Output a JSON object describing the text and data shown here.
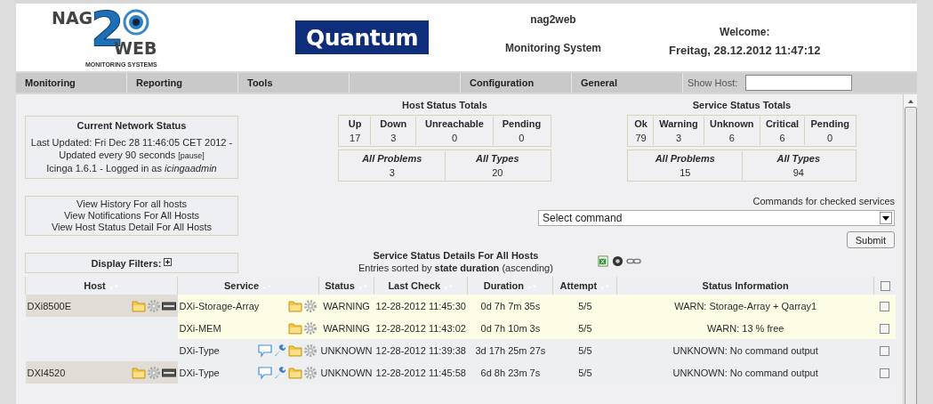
{
  "header": {
    "logo": {
      "top": "NAG",
      "digit": "2",
      "bottom": "WEB",
      "tagline": "MONITORING SYSTEMS"
    },
    "partner_logo": "Quantum",
    "site_name": "nag2web",
    "subtitle": "Monitoring System",
    "welcome": "Welcome:",
    "datetime": "Freitag, 28.12.2012 11:47:12"
  },
  "menu": {
    "left": [
      "Monitoring",
      "Reporting",
      "Tools"
    ],
    "right": [
      "Configuration",
      "General"
    ],
    "show_host_label": "Show Host:"
  },
  "network_status": {
    "title": "Current Network Status",
    "last_updated": "Last Updated: Fri Dec 28 11:46:05 CET 2012 -",
    "update_interval": "Updated every 90 seconds",
    "pause_link": "[pause]",
    "version": "Icinga 1.6.1 - Logged in as *icingaadmin*"
  },
  "links": [
    "View History For all hosts",
    "View Notifications For All Hosts",
    "View Host Status Detail For All Hosts"
  ],
  "host_totals": {
    "title": "Host Status Totals",
    "columns": [
      {
        "label": "Up",
        "value": "17"
      },
      {
        "label": "Down",
        "value": "3"
      },
      {
        "label": "Unreachable",
        "value": "0"
      },
      {
        "label": "Pending",
        "value": "0"
      }
    ],
    "summary": [
      {
        "label": "All Problems",
        "value": "3"
      },
      {
        "label": "All Types",
        "value": "20"
      }
    ]
  },
  "service_totals": {
    "title": "Service Status Totals",
    "columns": [
      {
        "label": "Ok",
        "value": "79"
      },
      {
        "label": "Warning",
        "value": "3"
      },
      {
        "label": "Unknown",
        "value": "6"
      },
      {
        "label": "Critical",
        "value": "6"
      },
      {
        "label": "Pending",
        "value": "0"
      }
    ],
    "summary": [
      {
        "label": "All Problems",
        "value": "15"
      },
      {
        "label": "All Types",
        "value": "94"
      }
    ]
  },
  "commands": {
    "label": "Commands for checked services",
    "select": "Select command",
    "submit": "Submit"
  },
  "filters": {
    "label": "Display Filters:"
  },
  "service_details": {
    "title": "Service Status Details For All Hosts",
    "sort_note": "Entries sorted by **state duration** (ascending)",
    "select_all_checked": false,
    "columns": [
      {
        "label": "Host",
        "sortable": true
      },
      {
        "label": "Service",
        "sortable": true
      },
      {
        "label": "Status",
        "sortable": true
      },
      {
        "label": "Last Check",
        "sortable": true
      },
      {
        "label": "Duration",
        "sortable": true
      },
      {
        "label": "Attempt",
        "sortable": true
      },
      {
        "label": "Status Information",
        "sortable": false
      }
    ],
    "rows": [
      {
        "host": "DXi8500E",
        "service": "DXi-Storage-Array",
        "status": "WARNING",
        "highlighted": true,
        "last_check": "12-28-2012 11:45:30",
        "duration": "0d 7h 7m 35s",
        "attempt": "5/5",
        "info": "WARN: Storage-Array + Qarray1",
        "comment": false,
        "acknowledged": false,
        "checked": false
      },
      {
        "service": "DXi-MEM",
        "status": "WARNING",
        "highlighted": true,
        "last_check": "12-28-2012 11:43:02",
        "duration": "0d 7h 10m 3s",
        "attempt": "5/5",
        "info": "WARN: 13 % free",
        "comment": false,
        "acknowledged": false,
        "checked": false
      },
      {
        "service": "DXi-Type",
        "status": "UNKNOWN",
        "highlighted": false,
        "last_check": "12-28-2012 11:39:38",
        "duration": "3d 17h 25m 27s",
        "attempt": "5/5",
        "info": "UNKNOWN: No command output",
        "comment": true,
        "acknowledged": true,
        "checked": false
      },
      {
        "host": "DXI4520",
        "service": "DXi-Type",
        "status": "UNKNOWN",
        "highlighted": false,
        "last_check": "12-28-2012 11:45:58",
        "duration": "6d 8h 23m 7s",
        "attempt": "5/5",
        "info": "UNKNOWN: No command output",
        "comment": true,
        "acknowledged": true,
        "checked": false
      }
    ]
  }
}
